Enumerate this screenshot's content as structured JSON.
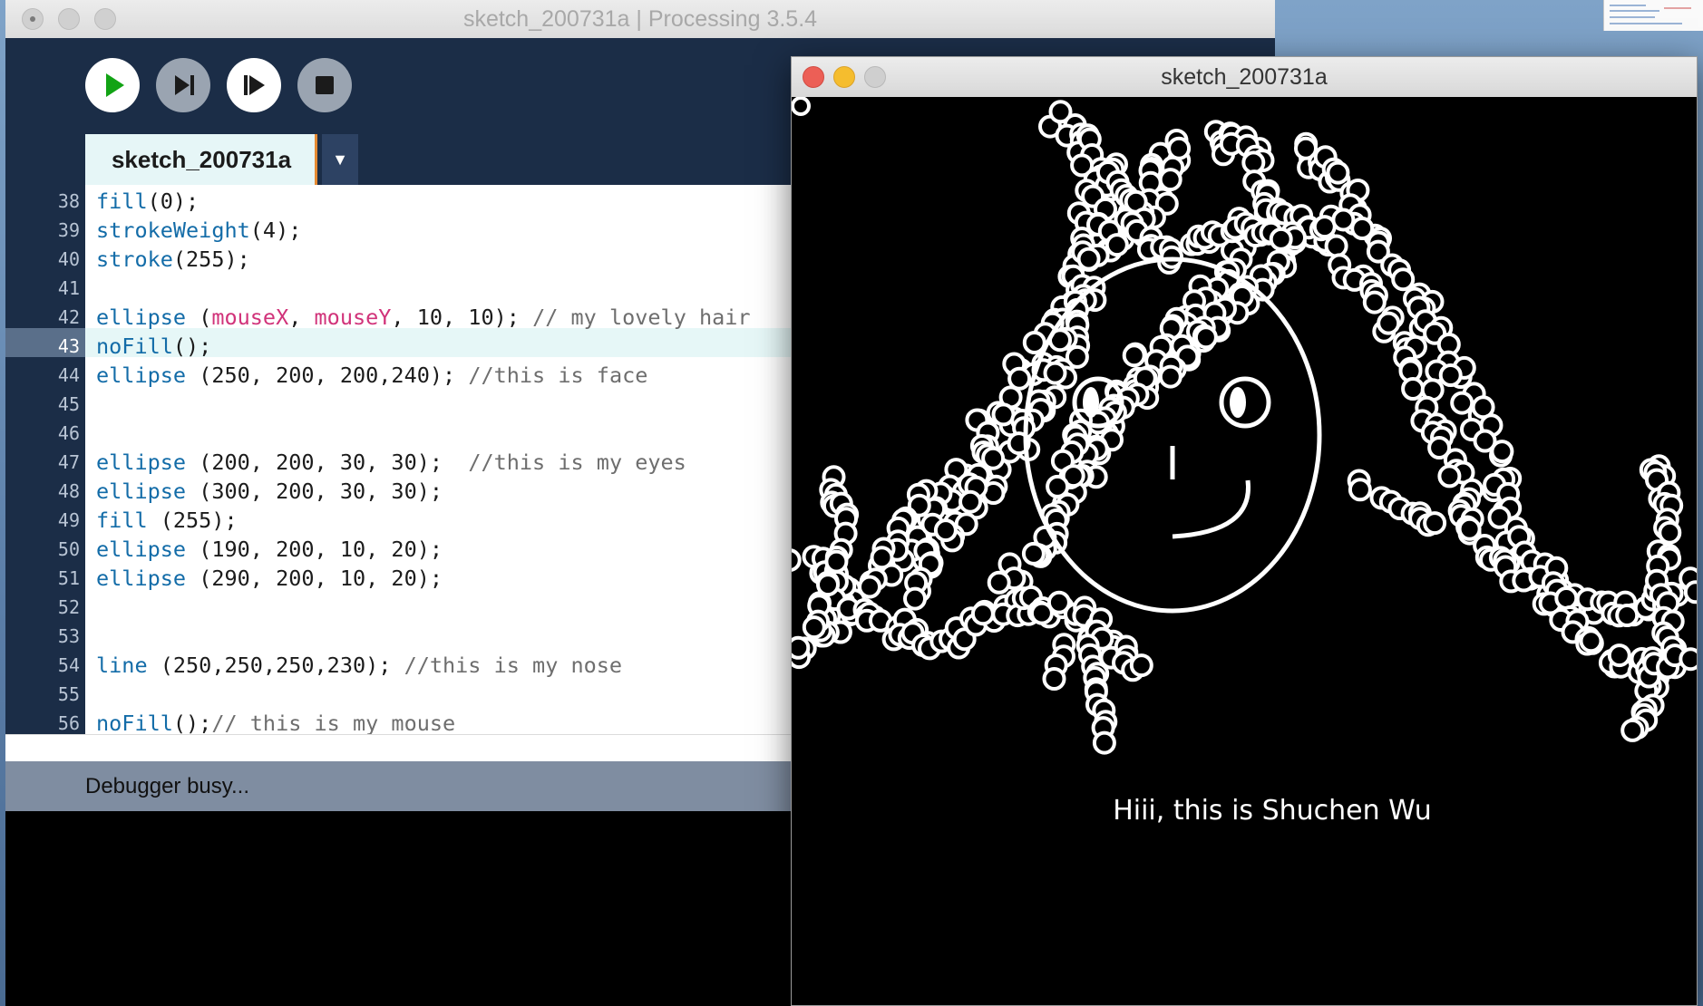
{
  "ide": {
    "title": "sketch_200731a | Processing 3.5.4",
    "toolbar": {
      "run": "run",
      "step": "step",
      "continue": "continue",
      "stop": "stop"
    },
    "tab": {
      "label": "sketch_200731a",
      "menu_glyph": "▼"
    },
    "lines": [
      {
        "no": "38",
        "tokens": [
          {
            "t": "fill",
            "c": "fn"
          },
          {
            "t": "(0);",
            "c": ""
          }
        ]
      },
      {
        "no": "39",
        "tokens": [
          {
            "t": "strokeWeight",
            "c": "fn"
          },
          {
            "t": "(4);",
            "c": ""
          }
        ]
      },
      {
        "no": "40",
        "tokens": [
          {
            "t": "stroke",
            "c": "fn"
          },
          {
            "t": "(255);",
            "c": ""
          }
        ]
      },
      {
        "no": "41",
        "tokens": []
      },
      {
        "no": "42",
        "tokens": [
          {
            "t": "ellipse",
            "c": "fn"
          },
          {
            "t": " (",
            "c": ""
          },
          {
            "t": "mouseX",
            "c": "var"
          },
          {
            "t": ", ",
            "c": ""
          },
          {
            "t": "mouseY",
            "c": "var"
          },
          {
            "t": ", 10, 10); ",
            "c": ""
          },
          {
            "t": "// my lovely hair",
            "c": "cmt"
          }
        ]
      },
      {
        "no": "43",
        "tokens": [
          {
            "t": "noFill",
            "c": "fn"
          },
          {
            "t": "();",
            "c": ""
          }
        ]
      },
      {
        "no": "44",
        "tokens": [
          {
            "t": "ellipse",
            "c": "fn"
          },
          {
            "t": " (250, 200, 200,240); ",
            "c": ""
          },
          {
            "t": "//this is face",
            "c": "cmt"
          }
        ]
      },
      {
        "no": "45",
        "tokens": []
      },
      {
        "no": "46",
        "tokens": []
      },
      {
        "no": "47",
        "tokens": [
          {
            "t": "ellipse",
            "c": "fn"
          },
          {
            "t": " (200, 200, 30, 30);  ",
            "c": ""
          },
          {
            "t": "//this is my eyes",
            "c": "cmt"
          }
        ]
      },
      {
        "no": "48",
        "tokens": [
          {
            "t": "ellipse",
            "c": "fn"
          },
          {
            "t": " (300, 200, 30, 30);",
            "c": ""
          }
        ]
      },
      {
        "no": "49",
        "tokens": [
          {
            "t": "fill",
            "c": "fn"
          },
          {
            "t": " (255);",
            "c": ""
          }
        ]
      },
      {
        "no": "50",
        "tokens": [
          {
            "t": "ellipse",
            "c": "fn"
          },
          {
            "t": " (190, 200, 10, 20);",
            "c": ""
          }
        ]
      },
      {
        "no": "51",
        "tokens": [
          {
            "t": "ellipse",
            "c": "fn"
          },
          {
            "t": " (290, 200, 10, 20);",
            "c": ""
          }
        ]
      },
      {
        "no": "52",
        "tokens": []
      },
      {
        "no": "53",
        "tokens": []
      },
      {
        "no": "54",
        "tokens": [
          {
            "t": "line",
            "c": "fn"
          },
          {
            "t": " (250,250,250,230); ",
            "c": ""
          },
          {
            "t": "//this is my nose",
            "c": "cmt"
          }
        ]
      },
      {
        "no": "55",
        "tokens": []
      },
      {
        "no": "56",
        "tokens": [
          {
            "t": "noFill",
            "c": "fn"
          },
          {
            "t": "();",
            "c": ""
          },
          {
            "t": "// this is my mouse",
            "c": "cmt"
          }
        ]
      }
    ],
    "highlighted_line": "43",
    "status": "Debugger busy..."
  },
  "sketch_window": {
    "title": "sketch_200731a",
    "caption": "Hiii, this is Shuchen Wu"
  },
  "colors": {
    "toolbar_bg": "#1b2d47",
    "run_green": "#12a315",
    "tab_bg": "#e6f6f7",
    "tab_accent": "#e58a32",
    "keyword_blue": "#136ca8",
    "var_pink": "#d1337a",
    "comment_gray": "#6e6e6e",
    "close_red": "#ec5f56",
    "minimize_yellow": "#f5bd2e"
  }
}
